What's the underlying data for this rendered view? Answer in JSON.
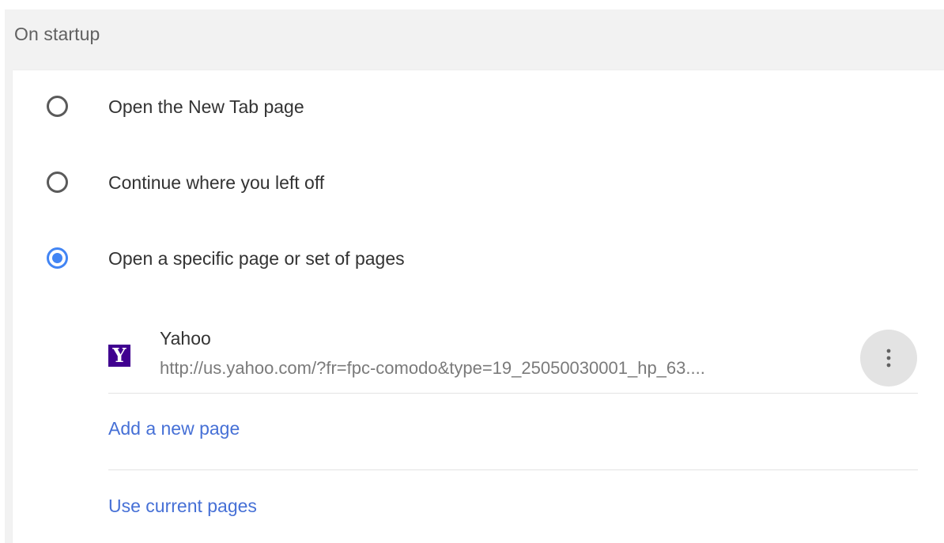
{
  "section": {
    "title": "On startup"
  },
  "options": [
    {
      "label": "Open the New Tab page",
      "checked": false
    },
    {
      "label": "Continue where you left off",
      "checked": false
    },
    {
      "label": "Open a specific page or set of pages",
      "checked": true
    }
  ],
  "page_entry": {
    "name": "Yahoo",
    "url": "http://us.yahoo.com/?fr=fpc-comodo&type=19_25050030001_hp_63....",
    "favicon_letter": "Y",
    "favicon_color": "#400090",
    "more_icon": "more-vert-icon"
  },
  "actions": {
    "add_page": "Add a new page",
    "use_current": "Use current pages"
  },
  "colors": {
    "accent": "#4285f4",
    "link": "#4670d6"
  }
}
